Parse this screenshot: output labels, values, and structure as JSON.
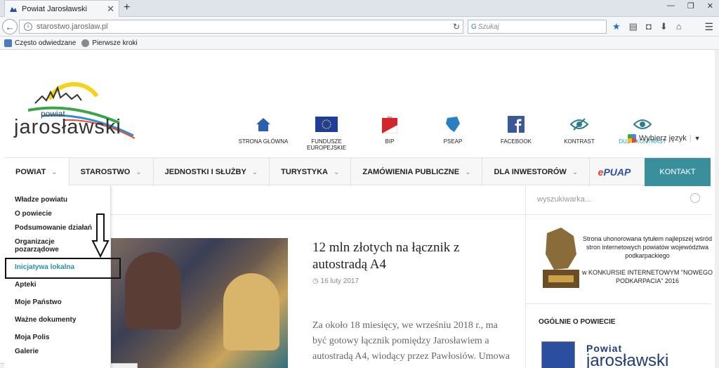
{
  "browser": {
    "tab_title": "Powiat Jarosławski",
    "url": "starostwo.jaroslaw.pl",
    "search_placeholder": "Szukaj",
    "bookmarks": [
      "Często odwiedzane",
      "Pierwsze kroki"
    ]
  },
  "site": {
    "logo_small": "powiat",
    "logo_big": "jarosławski",
    "top_icons": [
      {
        "label": "STRONA GŁÓWNA",
        "icon": "home-icon"
      },
      {
        "label": "FUNDUSZE EUROPEJSKIE",
        "icon": "eu-flag-icon"
      },
      {
        "label": "BIP",
        "icon": "bip-icon"
      },
      {
        "label": "PSEAP",
        "icon": "pseap-icon"
      },
      {
        "label": "FACEBOOK",
        "icon": "facebook-icon"
      },
      {
        "label": "KONTRAST",
        "icon": "contrast-eye-icon"
      },
      {
        "label": "DUŻY KONTRAST",
        "icon": "eye-icon"
      }
    ],
    "language": "Wybierz język",
    "menu": [
      {
        "label": "POWIAT"
      },
      {
        "label": "STAROSTWO"
      },
      {
        "label": "JEDNOSTKI I SŁUŻBY"
      },
      {
        "label": "TURYSTYKA"
      },
      {
        "label": "ZAMÓWIENIA PUBLICZNE"
      },
      {
        "label": "DLA INWESTORÓW"
      }
    ],
    "epuap_left": "e",
    "epuap_right": "PUAP",
    "kontakt": "KONTAKT",
    "dropdown": [
      "Władze powiatu",
      "O powiecie",
      "Podsumowanie działań",
      "Organizacje pozarządowe",
      "Inicjatywa lokalna",
      "Apteki",
      "Moje Państwo",
      "Ważne dokumenty",
      "Moja Polis",
      "Galerie"
    ],
    "article": {
      "title": "12 mln złotych na łącznik z autostradą A4",
      "date": "16 luty 2017",
      "excerpt": "Za około 18 miesięcy, we wrześniu 2018 r., ma być gotowy łącznik pomiędzy Jarosławiem a autostradą A4, wiodący przez Pawłosiów. Umowa na jego"
    },
    "search_site_placeholder": "wyszukiwarka...",
    "award_text": "Strona uhonorowana tytułem najlepszej wśród stron internetowych powiatów województwa podkarpackiego\n\nw KONKURSIE  INTERNETOWYM \"NOWEGO PODKARPACIA\" 2016",
    "ogolnie_heading": "OGÓLNIE O POWIECIE",
    "powiat_box_small": "Powiat",
    "powiat_box_big": "jarosławski",
    "accent_color": "#3a8f9c"
  }
}
